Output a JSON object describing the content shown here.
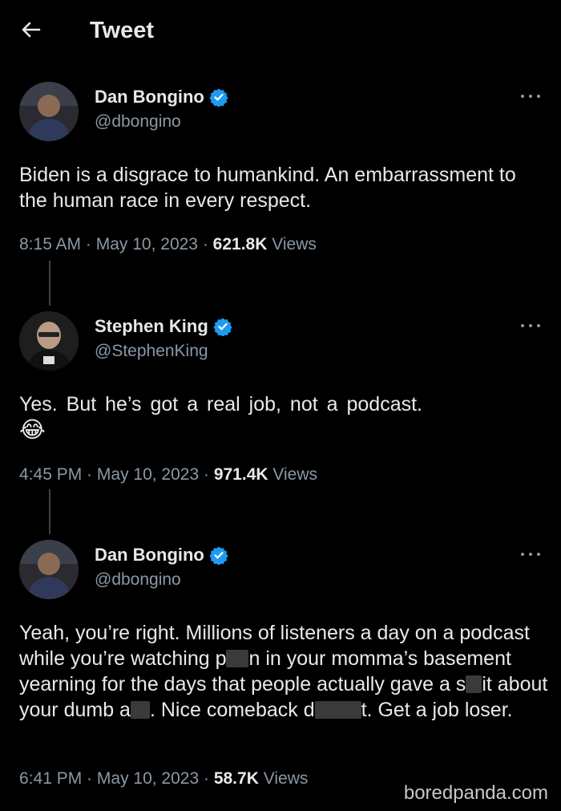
{
  "header": {
    "title": "Tweet"
  },
  "tweets": [
    {
      "name": "Dan Bongino",
      "handle": "@dbongino",
      "text": "Biden is a disgrace to humankind. An embarrassment to the human race in every respect.",
      "time": "8:15 AM",
      "date": "May 10, 2023",
      "views_count": "621.8K",
      "views_label": "Views"
    },
    {
      "name": "Stephen King",
      "handle": "@StephenKing",
      "text": "Yes. But he’s got a real job, not a podcast.",
      "emoji": "😂",
      "time": "4:45 PM",
      "date": "May 10, 2023",
      "views_count": "971.4K",
      "views_label": "Views"
    },
    {
      "name": "Dan Bongino",
      "handle": "@dbongino",
      "text_parts": {
        "a": "Yeah, you’re right. Millions of listeners a day on a podcast while you’re watching p",
        "b": "n in your momma’s basement yearning for the days that people actually gave a s",
        "c": "it about your dumb a",
        "d": ". Nice comeback d",
        "e": "t. Get a job loser."
      },
      "time": "6:41 PM",
      "date": "May 10, 2023",
      "views_count": "58.7K",
      "views_label": "Views"
    }
  ],
  "watermark": "boredpanda.com",
  "colors": {
    "background": "#000000",
    "text": "#e7e9ea",
    "secondary": "#8b98a5",
    "verified": "#1d9bf0"
  },
  "icons": {
    "back": "arrow-left-icon",
    "verified": "verified-badge-icon",
    "more": "more-dots-icon"
  }
}
